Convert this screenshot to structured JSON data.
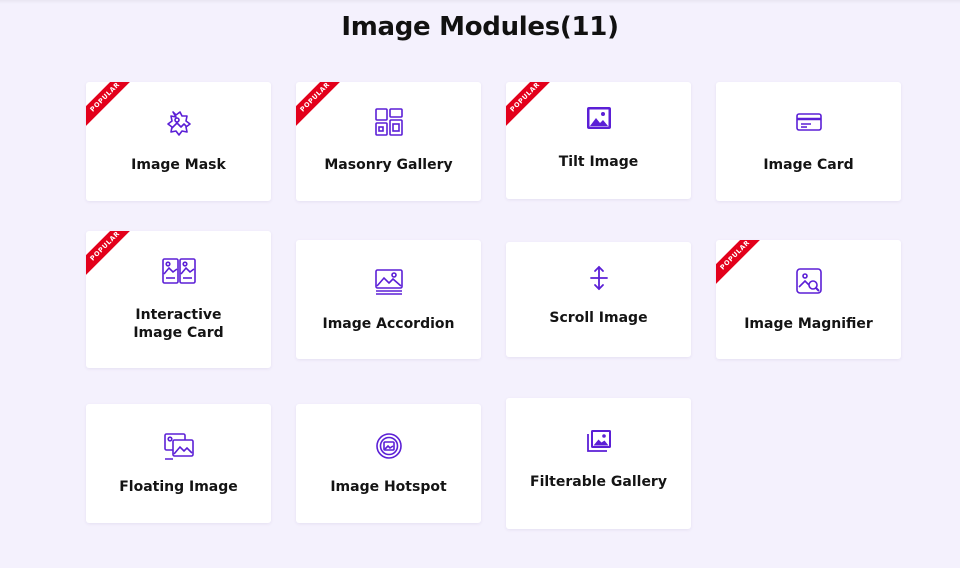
{
  "page": {
    "title": "Image Modules(11)"
  },
  "badge_label": "POPULAR",
  "colors": {
    "accent": "#5b1fd6",
    "badge": "#e3001b",
    "background": "#f4f1fd"
  },
  "modules": [
    {
      "label": "Image Mask",
      "icon": "image-mask-icon",
      "popular": true
    },
    {
      "label": "Masonry Gallery",
      "icon": "masonry-gallery-icon",
      "popular": true
    },
    {
      "label": "Tilt Image",
      "icon": "tilt-image-icon",
      "popular": true
    },
    {
      "label": "Image Card",
      "icon": "image-card-icon",
      "popular": false
    },
    {
      "label_line1": "Interactive",
      "label_line2": "Image Card",
      "icon": "interactive-image-card-icon",
      "popular": true
    },
    {
      "label": "Image Accordion",
      "icon": "image-accordion-icon",
      "popular": false
    },
    {
      "label": "Scroll Image",
      "icon": "scroll-image-icon",
      "popular": false
    },
    {
      "label": "Image Magnifier",
      "icon": "image-magnifier-icon",
      "popular": true
    },
    {
      "label": "Floating Image",
      "icon": "floating-image-icon",
      "popular": false
    },
    {
      "label": "Image Hotspot",
      "icon": "image-hotspot-icon",
      "popular": false
    },
    {
      "label": "Filterable Gallery",
      "icon": "filterable-gallery-icon",
      "popular": false
    }
  ]
}
